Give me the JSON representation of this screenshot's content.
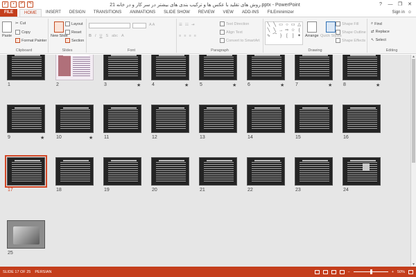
{
  "titlebar": {
    "title": "روش های تقلید با عکس‌ ها و ترکیب‌ بندی‌ های بیشتر در سر کار و در خانه 21.pptx - PowerPoint",
    "minimize": "—",
    "restore": "❐",
    "close": "✕",
    "help": "?"
  },
  "ribbon_tabs": [
    "FILE",
    "HOME",
    "INSERT",
    "DESIGN",
    "TRANSITIONS",
    "ANIMATIONS",
    "SLIDE SHOW",
    "REVIEW",
    "VIEW",
    "ADD-INS",
    "FILEminimizer"
  ],
  "active_tab": "HOME",
  "sign_in": "Sign in",
  "clipboard": {
    "paste": "Paste",
    "cut": "Cut",
    "copy": "Copy",
    "format_painter": "Format Painter",
    "label": "Clipboard"
  },
  "slides_group": {
    "new_slide": "New Slide",
    "layout": "Layout",
    "reset": "Reset",
    "section": "Section",
    "label": "Slides"
  },
  "font_group": {
    "label": "Font"
  },
  "paragraph_group": {
    "text_direction": "Text Direction",
    "align_text": "Align Text",
    "convert_smartart": "Convert to SmartArt",
    "label": "Paragraph"
  },
  "drawing_group": {
    "arrange": "Arrange",
    "quick_styles": "Quick Styles",
    "shape_fill": "Shape Fill",
    "shape_outline": "Shape Outline",
    "shape_effects": "Shape Effects",
    "label": "Drawing"
  },
  "editing_group": {
    "find": "Find",
    "replace": "Replace",
    "select": "Select",
    "label": "Editing"
  },
  "slides": [
    {
      "num": "1",
      "kind": "dark",
      "star": ""
    },
    {
      "num": "2",
      "kind": "light",
      "star": ""
    },
    {
      "num": "3",
      "kind": "dark",
      "star": "★"
    },
    {
      "num": "4",
      "kind": "dark",
      "star": "★"
    },
    {
      "num": "5",
      "kind": "dark",
      "star": "★"
    },
    {
      "num": "6",
      "kind": "dark",
      "star": "★"
    },
    {
      "num": "7",
      "kind": "dark",
      "star": "★"
    },
    {
      "num": "8",
      "kind": "dark",
      "star": "★"
    },
    {
      "num": "9",
      "kind": "dark",
      "star": "★"
    },
    {
      "num": "10",
      "kind": "dark",
      "star": "★"
    },
    {
      "num": "11",
      "kind": "dark",
      "star": ""
    },
    {
      "num": "12",
      "kind": "dark",
      "star": ""
    },
    {
      "num": "13",
      "kind": "dark",
      "star": ""
    },
    {
      "num": "14",
      "kind": "dark",
      "star": ""
    },
    {
      "num": "15",
      "kind": "dark",
      "star": ""
    },
    {
      "num": "16",
      "kind": "dark",
      "star": ""
    },
    {
      "num": "17",
      "kind": "dark",
      "star": "",
      "selected": true
    },
    {
      "num": "18",
      "kind": "dark",
      "star": ""
    },
    {
      "num": "19",
      "kind": "dark",
      "star": ""
    },
    {
      "num": "20",
      "kind": "dark",
      "star": ""
    },
    {
      "num": "21",
      "kind": "dark",
      "star": ""
    },
    {
      "num": "22",
      "kind": "dark",
      "star": ""
    },
    {
      "num": "23",
      "kind": "dark",
      "star": ""
    },
    {
      "num": "24",
      "kind": "dark-img",
      "star": ""
    },
    {
      "num": "25",
      "kind": "photo",
      "star": ""
    }
  ],
  "statusbar": {
    "slide_info": "SLIDE 17 OF 25",
    "language": "PERSIAN",
    "zoom": "50%"
  },
  "colors": {
    "accent": "#c43e1c",
    "selection": "#d24726",
    "sorter_bg": "#e6e6e6"
  }
}
